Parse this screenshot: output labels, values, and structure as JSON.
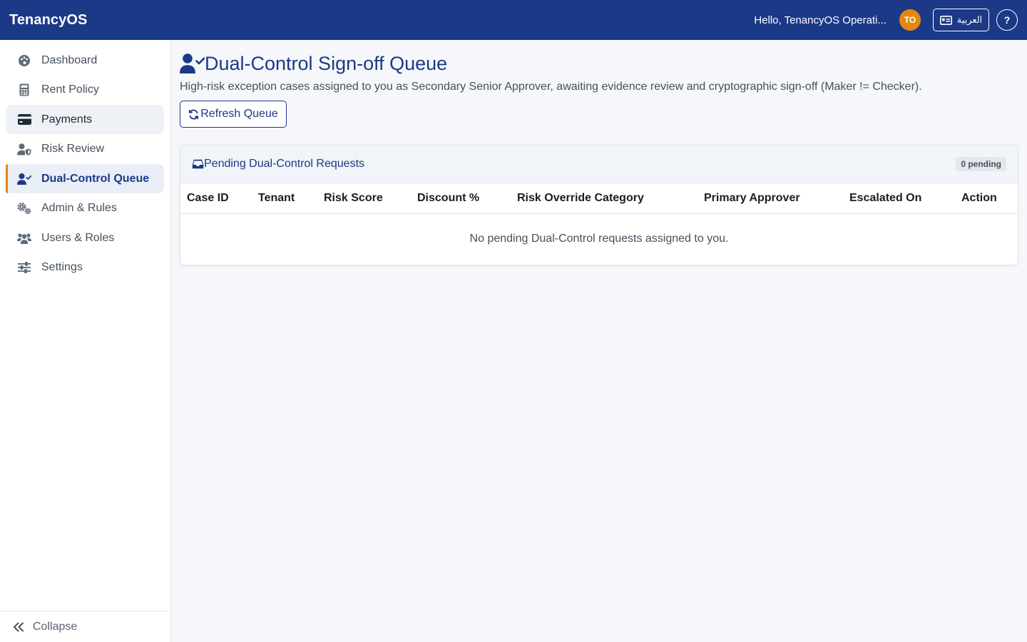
{
  "app": {
    "brand": "TenancyOS",
    "greeting": "Hello, TenancyOS Operati...",
    "avatar_initials": "TO",
    "language_button": "العربية",
    "help_label": "?"
  },
  "sidebar": {
    "items": [
      {
        "label": "Dashboard",
        "icon": "palette-icon"
      },
      {
        "label": "Rent Policy",
        "icon": "calculator-icon"
      },
      {
        "label": "Payments",
        "icon": "credit-card-icon"
      },
      {
        "label": "Risk Review",
        "icon": "user-shield-icon"
      },
      {
        "label": "Dual-Control Queue",
        "icon": "user-check-icon"
      },
      {
        "label": "Admin & Rules",
        "icon": "gears-icon"
      },
      {
        "label": "Users & Roles",
        "icon": "users-icon"
      },
      {
        "label": "Settings",
        "icon": "sliders-icon"
      }
    ],
    "active_item": "Dual-Control Queue",
    "hovered_item": "Payments",
    "collapse_label": "Collapse"
  },
  "page": {
    "title": "Dual-Control Sign-off Queue",
    "subtitle": "High-risk exception cases assigned to you as Secondary Senior Approver, awaiting evidence review and cryptographic sign-off (Maker != Checker).",
    "refresh_button": "Refresh Queue"
  },
  "queue": {
    "title": "Pending Dual-Control Requests",
    "pending_badge": "0 pending",
    "columns": [
      "Case ID",
      "Tenant",
      "Risk Score",
      "Discount %",
      "Risk Override Category",
      "Primary Approver",
      "Escalated On",
      "Action"
    ],
    "empty_message": "No pending Dual-Control requests assigned to you."
  },
  "colors": {
    "primary": "#1c3988",
    "accent": "#e3870f",
    "background": "#f5f7fa"
  }
}
